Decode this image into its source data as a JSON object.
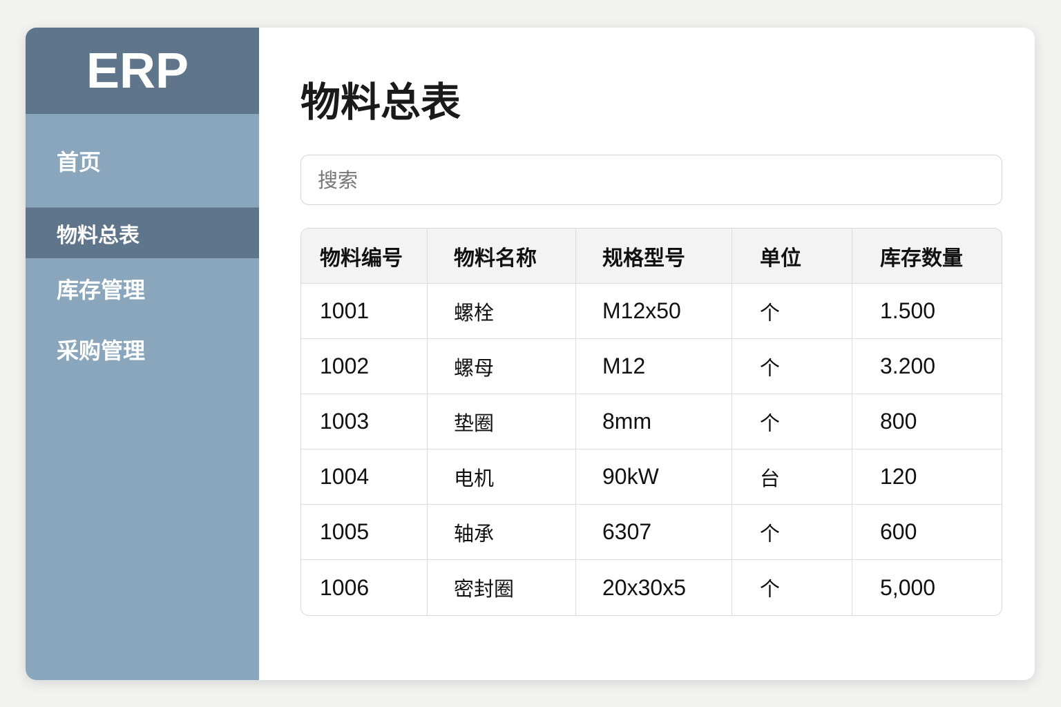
{
  "app": {
    "logo": "ERP"
  },
  "sidebar": {
    "items": [
      {
        "label": "首页"
      },
      {
        "label": "物料总表",
        "active": true
      },
      {
        "label": "库存管理"
      },
      {
        "label": "采购管理"
      }
    ]
  },
  "main": {
    "title": "物料总表",
    "search": {
      "placeholder": "搜索",
      "value": ""
    }
  },
  "table": {
    "headers": [
      "物料编号",
      "物料名称",
      "规格型号",
      "单位",
      "库存数量"
    ],
    "rows": [
      [
        "1001",
        "螺栓",
        "M12x50",
        "个",
        "1.500"
      ],
      [
        "1002",
        "螺母",
        "M12",
        "个",
        "3.200"
      ],
      [
        "1003",
        "垫圈",
        "8mm",
        "个",
        "800"
      ],
      [
        "1004",
        "电机",
        "90kW",
        "台",
        "120"
      ],
      [
        "1005",
        "轴承",
        "6307",
        "个",
        "600"
      ],
      [
        "1006",
        "密封圈",
        "20x30x5",
        "个",
        "5,000"
      ]
    ]
  },
  "colors": {
    "sidebar": "#8aa6bd",
    "sidebar_dark": "#5f758c"
  }
}
